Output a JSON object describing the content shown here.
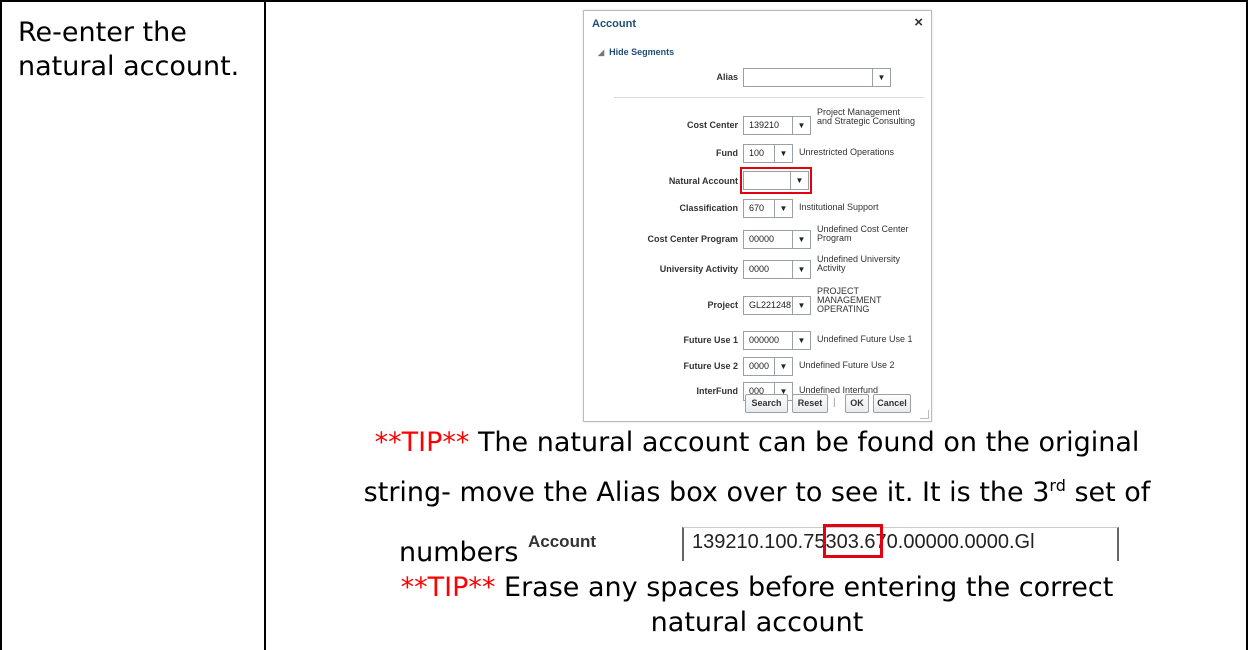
{
  "step": {
    "instruction": "Re-enter the natural account."
  },
  "dialog": {
    "title": "Account",
    "close_glyph": "×",
    "hide_segments_label": "Hide Segments",
    "alias_label": "Alias",
    "alias_value": "",
    "segments": [
      {
        "label": "Cost Center",
        "value": "139210",
        "desc": [
          "Project Management",
          "and Strategic Consulting"
        ]
      },
      {
        "label": "Fund",
        "value": "100",
        "desc": [
          "Unrestricted Operations"
        ]
      },
      {
        "label": "Natural Account",
        "value": "",
        "desc": []
      },
      {
        "label": "Classification",
        "value": "670",
        "desc": [
          "Institutional Support"
        ]
      },
      {
        "label": "Cost Center Program",
        "value": "00000",
        "desc": [
          "Undefined Cost Center",
          "Program"
        ]
      },
      {
        "label": "University Activity",
        "value": "0000",
        "desc": [
          "Undefined University",
          "Activity"
        ]
      },
      {
        "label": "Project",
        "value": "GL221248",
        "desc": [
          "PROJECT",
          "MANAGEMENT",
          "OPERATING"
        ]
      },
      {
        "label": "Future Use 1",
        "value": "000000",
        "desc": [
          "Undefined Future Use 1"
        ]
      },
      {
        "label": "Future Use 2",
        "value": "0000",
        "desc": [
          "Undefined Future Use 2"
        ]
      },
      {
        "label": "InterFund",
        "value": "000",
        "desc": [
          "Undefined Interfund"
        ]
      }
    ],
    "buttons": {
      "search": "Search",
      "reset": "Reset",
      "separator": "|",
      "ok": "OK",
      "cancel": "Cancel"
    }
  },
  "tips": {
    "tip_marker": "**TIP**",
    "tip1_line1": " The natural account can be found on the original",
    "tip1_line2": "string- move the Alias box over to see it. It is the 3",
    "tip1_sup": "rd",
    "tip1_line2_end": " set of",
    "tip1_line3": "numbers",
    "account_label": "Account",
    "account_string": "139210.100.75303.670.00000.0000.Gl",
    "tip2_line1": " Erase any spaces before entering the correct",
    "tip2_line2": "natural account"
  },
  "colors": {
    "tip_red": "#ff0000",
    "highlight_red": "#e3000f",
    "dialog_title": "#1f4e79"
  }
}
